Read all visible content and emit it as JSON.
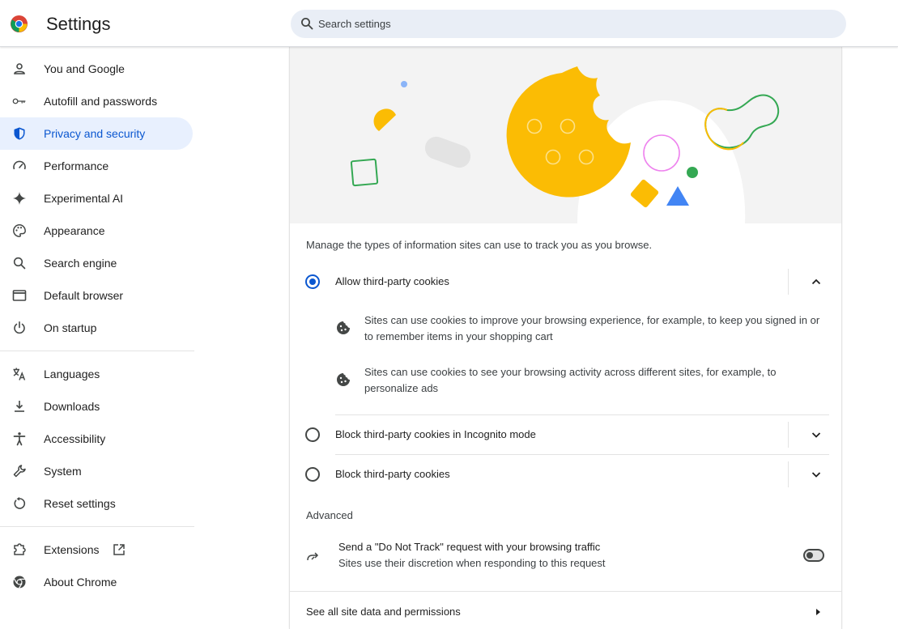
{
  "app": {
    "title": "Settings",
    "logo_icon": "chrome-logo-icon"
  },
  "search": {
    "placeholder": "Search settings",
    "icon": "search-icon"
  },
  "sidebar": {
    "items": [
      {
        "label": "You and Google",
        "icon": "person-icon"
      },
      {
        "label": "Autofill and passwords",
        "icon": "key-icon"
      },
      {
        "label": "Privacy and security",
        "icon": "shield-icon",
        "active": true
      },
      {
        "label": "Performance",
        "icon": "speedometer-icon"
      },
      {
        "label": "Experimental AI",
        "icon": "sparkle-icon"
      },
      {
        "label": "Appearance",
        "icon": "palette-icon"
      },
      {
        "label": "Search engine",
        "icon": "search-icon"
      },
      {
        "label": "Default browser",
        "icon": "browser-window-icon"
      },
      {
        "label": "On startup",
        "icon": "power-icon"
      },
      {
        "label": "Languages",
        "icon": "translate-icon"
      },
      {
        "label": "Downloads",
        "icon": "download-icon"
      },
      {
        "label": "Accessibility",
        "icon": "accessibility-icon"
      },
      {
        "label": "System",
        "icon": "wrench-icon"
      },
      {
        "label": "Reset settings",
        "icon": "reset-icon"
      },
      {
        "label": "Extensions",
        "icon": "puzzle-icon",
        "external_icon": "open-in-new-icon"
      },
      {
        "label": "About Chrome",
        "icon": "chrome-icon"
      }
    ]
  },
  "main": {
    "description": "Manage the types of information sites can use to track you as you browse.",
    "options": [
      {
        "label": "Allow third-party cookies",
        "checked": true,
        "expanded": true,
        "details": [
          {
            "icon": "cookie-icon",
            "text": "Sites can use cookies to improve your browsing experience, for example, to keep you signed in or to remember items in your shopping cart"
          },
          {
            "icon": "cookie-icon",
            "text": "Sites can use cookies to see your browsing activity across different sites, for example, to personalize ads"
          }
        ]
      },
      {
        "label": "Block third-party cookies in Incognito mode",
        "checked": false,
        "expanded": false
      },
      {
        "label": "Block third-party cookies",
        "checked": false,
        "expanded": false
      }
    ],
    "advanced": {
      "title": "Advanced",
      "dnt": {
        "title": "Send a \"Do Not Track\" request with your browsing traffic",
        "subtitle": "Sites use their discretion when responding to this request",
        "enabled": false,
        "icon": "forward-arrow-icon"
      }
    },
    "see_all": {
      "label": "See all site data and permissions",
      "icon": "arrow-right-icon"
    }
  },
  "colors": {
    "accent": "#0b57d0",
    "active_bg": "#e8f0fe",
    "search_bg": "#e9eef6",
    "cookie_yellow": "#fbbc04",
    "google_green": "#34a853",
    "google_blue": "#4285f4"
  }
}
